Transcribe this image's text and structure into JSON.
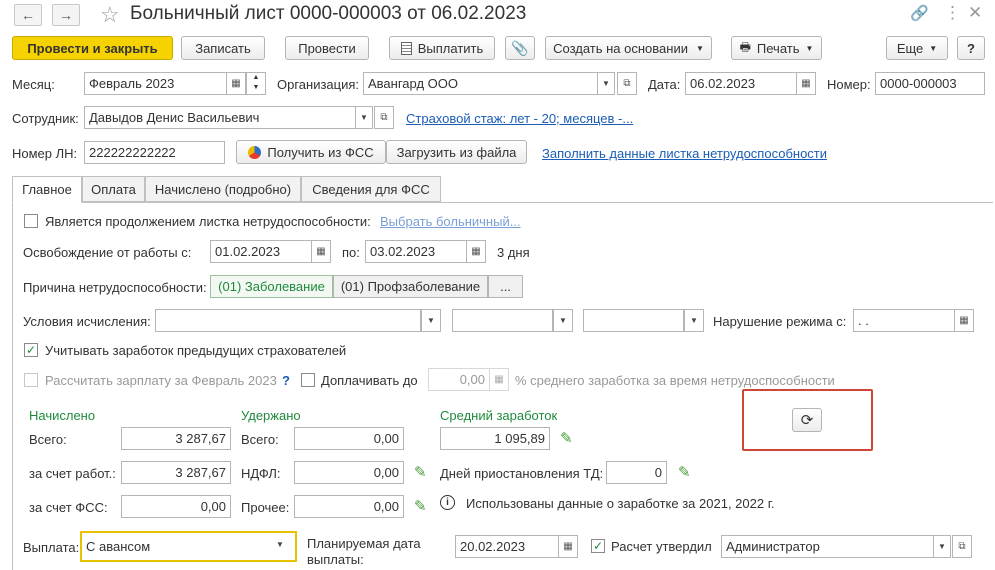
{
  "header": {
    "title": "Больничный лист 0000-000003 от 06.02.2023",
    "back_icon": "←",
    "forward_icon": "→",
    "star_icon": "☆",
    "link_icon": "🔗",
    "more_icon": "⋮",
    "close_icon": "✕"
  },
  "toolbar": {
    "post_close": "Провести и закрыть",
    "save": "Записать",
    "post": "Провести",
    "pay": "Выплатить",
    "create_based": "Создать на основании",
    "print": "Печать",
    "more": "Еще",
    "help": "?"
  },
  "form": {
    "month_label": "Месяц:",
    "month_value": "Февраль 2023",
    "org_label": "Организация:",
    "org_value": "Авангард ООО",
    "date_label": "Дата:",
    "date_value": "06.02.2023",
    "number_label": "Номер:",
    "number_value": "0000-000003",
    "employee_label": "Сотрудник:",
    "employee_value": "Давыдов Денис Васильевич",
    "insurance_link": "Страховой стаж: лет - 20; месяцев -...",
    "ln_label": "Номер ЛН:",
    "ln_value": "222222222222",
    "get_fss": "Получить из ФСС",
    "load_file": "Загрузить из файла",
    "fill_link": "Заполнить данные листка нетрудоспособности"
  },
  "tabs": [
    "Главное",
    "Оплата",
    "Начислено (подробно)",
    "Сведения для ФСС"
  ],
  "main": {
    "continuation_label": "Является продолжением листка нетрудоспособности:",
    "choose_link": "Выбрать больничный...",
    "release_label": "Освобождение от работы с:",
    "release_from": "01.02.2023",
    "release_to_label": "по:",
    "release_to": "03.02.2023",
    "days": "3 дня",
    "reason_label": "Причина нетрудоспособности:",
    "reason_1": "(01) Заболевание",
    "reason_2": "(01) Профзаболевание",
    "reason_more": "...",
    "conditions_label": "Условия исчисления:",
    "violation_label": "Нарушение режима с:",
    "violation_value": " .  .",
    "prev_insurers_label": "Учитывать заработок предыдущих страхователей",
    "calc_salary_label": "Рассчитать зарплату за Февраль 2023",
    "question": "?",
    "extra_pay_label": "Доплачивать до",
    "extra_pay_value": "0,00",
    "avg_pct_label": "% среднего заработка за время нетрудоспособности"
  },
  "totals": {
    "accrued_header": "Начислено",
    "withheld_header": "Удержано",
    "avg_header": "Средний заработок",
    "total_label": "Всего:",
    "total_value": "3 287,67",
    "employer_label": "за счет работ.:",
    "employer_value": "3 287,67",
    "fss_label": "за счет ФСС:",
    "fss_value": "0,00",
    "w_total_label": "Всего:",
    "w_total_value": "0,00",
    "ndfl_label": "НДФЛ:",
    "ndfl_value": "0,00",
    "other_label": "Прочее:",
    "other_value": "0,00",
    "avg_value": "1 095,89",
    "suspend_label": "Дней приостановления ТД:",
    "suspend_value": "0",
    "info_text": "Использованы данные о заработке за  2021,  2022 г."
  },
  "footer": {
    "payout_label": "Выплата:",
    "payout_value": "С авансом",
    "planned_label_1": "Планируемая дата",
    "planned_label_2": "выплаты:",
    "planned_value": "20.02.2023",
    "approved_label": "Расчет утвердил",
    "approved_value": "Администратор"
  },
  "colors": {
    "primary_button": "#f5d200",
    "link": "#1c5db5",
    "green_label": "#1f8a3c",
    "highlight": "#d0453a"
  }
}
